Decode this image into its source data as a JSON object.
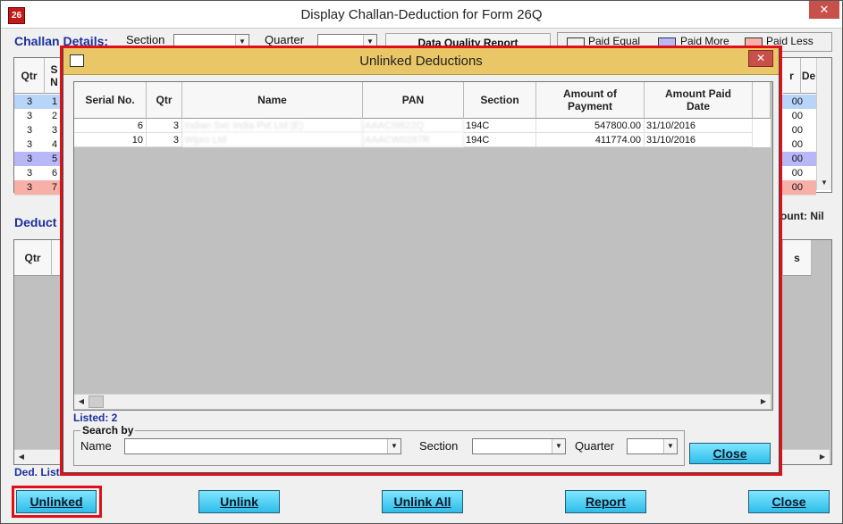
{
  "window": {
    "app_icon": "26",
    "title": "Display Challan-Deduction for Form 26Q",
    "close": "✕"
  },
  "challan": {
    "heading": "Challan Details:",
    "section_label": "Section",
    "quarter_label": "Quarter",
    "dq_report": "Data Quality Report",
    "legend": [
      {
        "label": "Paid Equal",
        "color": "#ffffff"
      },
      {
        "label": "Paid More",
        "color": "#b8b8f8"
      },
      {
        "label": "Paid Less",
        "color": "#f6b0a8"
      }
    ],
    "col_qtr": "Qtr",
    "col_s": "S",
    "col_s2": "N",
    "col_right_top": "r",
    "col_right_de": "De",
    "rows": [
      {
        "qtr": "3",
        "s": "1",
        "right": "00",
        "color": "#b8d4f8"
      },
      {
        "qtr": "3",
        "s": "2",
        "right": "00",
        "color": "#ffffff"
      },
      {
        "qtr": "3",
        "s": "3",
        "right": "00",
        "color": "#ffffff"
      },
      {
        "qtr": "3",
        "s": "4",
        "right": "00",
        "color": "#ffffff"
      },
      {
        "qtr": "3",
        "s": "5",
        "right": "00",
        "color": "#b8b8f8"
      },
      {
        "qtr": "3",
        "s": "6",
        "right": "00",
        "color": "#ffffff"
      },
      {
        "qtr": "3",
        "s": "7",
        "right": "00",
        "color": "#f6b0a8"
      }
    ],
    "amount_label": "ount: Nil"
  },
  "deduction": {
    "heading": "Deduct",
    "col_qtr": "Qtr",
    "col_right": "s",
    "list_label": "Ded. List"
  },
  "dialog": {
    "title": "Unlinked Deductions",
    "close": "✕",
    "columns": [
      "Serial No.",
      "Qtr",
      "Name",
      "PAN",
      "Section",
      "Amount of Payment",
      "Amount Paid Date"
    ],
    "rows": [
      {
        "serial": "6",
        "qtr": "3",
        "name": "Indian Svc India Pvt Ltd (E)",
        "pan": "AAACI9822Q",
        "section": "194C",
        "amount": "547800.00",
        "date": "31/10/2016"
      },
      {
        "serial": "10",
        "qtr": "3",
        "name": "Wipro Ltd",
        "pan": "AAACW0287R",
        "section": "194C",
        "amount": "411774.00",
        "date": "31/10/2016"
      }
    ],
    "listed": "Listed: 2",
    "search_by": "Search by",
    "name_label": "Name",
    "section_label": "Section",
    "quarter_label": "Quarter",
    "close_button": "Close"
  },
  "buttons": {
    "unlinked": "Unlinked",
    "unlink": "Unlink",
    "unlink_all": "Unlink All",
    "report": "Report",
    "close": "Close"
  },
  "colors": {
    "button_top": "#7ee6ff",
    "button_bottom": "#2fbde9",
    "highlight": "#e0101a",
    "dialog_title": "#e9c766",
    "label_blue": "#1a2fa0"
  }
}
